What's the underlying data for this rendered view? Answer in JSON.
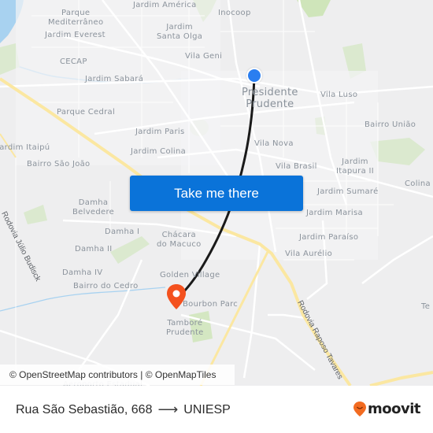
{
  "map": {
    "places": [
      {
        "name": "Jardim América",
        "label": "Jardim América"
      },
      {
        "name": "Inocoop",
        "label": "Inocoop"
      },
      {
        "name": "Parque Mediterrâneo",
        "label": "Parque\nMediterrâneo"
      },
      {
        "name": "Jardim Everest",
        "label": "Jardim Everest"
      },
      {
        "name": "Jardim Santa Olga",
        "label": "Jardim\nSanta Olga"
      },
      {
        "name": "CECAP",
        "label": "CECAP"
      },
      {
        "name": "Vila Geni",
        "label": "Vila Geni"
      },
      {
        "name": "Jardim Sabará",
        "label": "Jardim Sabará"
      },
      {
        "name": "Presidente Prudente",
        "label": "Presidente\nPrudente"
      },
      {
        "name": "Vila Luso",
        "label": "Vila Luso"
      },
      {
        "name": "Parque Cedral",
        "label": "Parque Cedral"
      },
      {
        "name": "Jardim Paris",
        "label": "Jardim Paris"
      },
      {
        "name": "Bairro União",
        "label": "Bairro União"
      },
      {
        "name": "Jardim Itaipú",
        "label": "Jardim Itaipú"
      },
      {
        "name": "Vila Nova",
        "label": "Vila Nova"
      },
      {
        "name": "Jardim Colina",
        "label": "Jardim Colina"
      },
      {
        "name": "Bairro São João",
        "label": "Bairro São João"
      },
      {
        "name": "Vila Brasil",
        "label": "Vila Brasil"
      },
      {
        "name": "Jardim Itapura II",
        "label": "Jardim\nItapura II"
      },
      {
        "name": "Colina",
        "label": "Colina"
      },
      {
        "name": "Jardim Sumaré",
        "label": "Jardim Sumaré"
      },
      {
        "name": "Damha Belvedere",
        "label": "Damha\nBelvedere"
      },
      {
        "name": "Jardim Marisa",
        "label": "Jardim Marisa"
      },
      {
        "name": "Damha I",
        "label": "Damha I"
      },
      {
        "name": "Chácara do Macuco",
        "label": "Chácara\ndo Macuco"
      },
      {
        "name": "Jardim Paraíso",
        "label": "Jardim Paraíso"
      },
      {
        "name": "Damha II",
        "label": "Damha II"
      },
      {
        "name": "Vila Aurélio",
        "label": "Vila Aurélio"
      },
      {
        "name": "Damha IV",
        "label": "Damha IV"
      },
      {
        "name": "Golden Village",
        "label": "Golden Village"
      },
      {
        "name": "Bairro do Cedro",
        "label": "Bairro do Cedro"
      },
      {
        "name": "Bourbon Parc",
        "label": "Bourbon Parc"
      },
      {
        "name": "Tamboré Prudente",
        "label": "Tamboré\nPrudente"
      },
      {
        "name": "Te",
        "label": "Te"
      },
      {
        "name": "Aeroporto Estadual",
        "label": "Aeroporto Estadual"
      }
    ],
    "roads": {
      "rodovia_julio": "Rodovia Júlio Budisck",
      "rodovia_raposo": "Rodovia Raposo Tavares"
    },
    "origin_marker": "origin",
    "destination_marker": "destination",
    "colors": {
      "route": "#1a1a1a",
      "origin": "#2a7ef0",
      "destination": "#f4511e",
      "highway": "#fbe7a1",
      "park": "#c9e2b3",
      "water": "#a8d2f0"
    }
  },
  "cta": {
    "label": "Take me there"
  },
  "attribution": {
    "osm": "© OpenStreetMap contributors",
    "separator": " | ",
    "omt": "© OpenMapTiles"
  },
  "footer": {
    "origin": "Rua São Sebastião, 668",
    "arrow": "⟶",
    "destination": "UNIESP",
    "brand": "moovit",
    "brand_color": "#f26b21"
  }
}
